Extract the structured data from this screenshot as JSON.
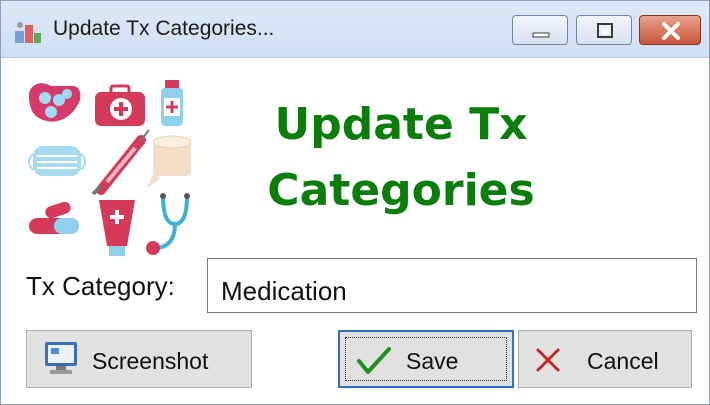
{
  "window": {
    "title": "Update Tx Categories...",
    "title_icon": "medical-app-icon",
    "controls": {
      "minimize_icon": "minimize-icon",
      "maximize_icon": "maximize-icon",
      "close_icon": "close-icon"
    }
  },
  "header": {
    "line1": "Update Tx",
    "line2": "Categories",
    "color": "#0b7d0b",
    "clipart_icons": [
      "pills-icon",
      "first-aid-kit-icon",
      "medicine-bottle-icon",
      "face-mask-icon",
      "syringe-icon",
      "bandage-roll-icon",
      "capsule-icon",
      "ointment-tube-icon",
      "stethoscope-icon"
    ]
  },
  "form": {
    "category_label": "Tx Category:",
    "category_value": "Medication"
  },
  "buttons": {
    "screenshot": {
      "label": "Screenshot",
      "icon": "monitor-icon"
    },
    "save": {
      "label": "Save",
      "icon": "checkmark-icon",
      "icon_color": "#1f8f1f"
    },
    "cancel": {
      "label": "Cancel",
      "icon": "x-icon",
      "icon_color": "#c62828"
    }
  }
}
